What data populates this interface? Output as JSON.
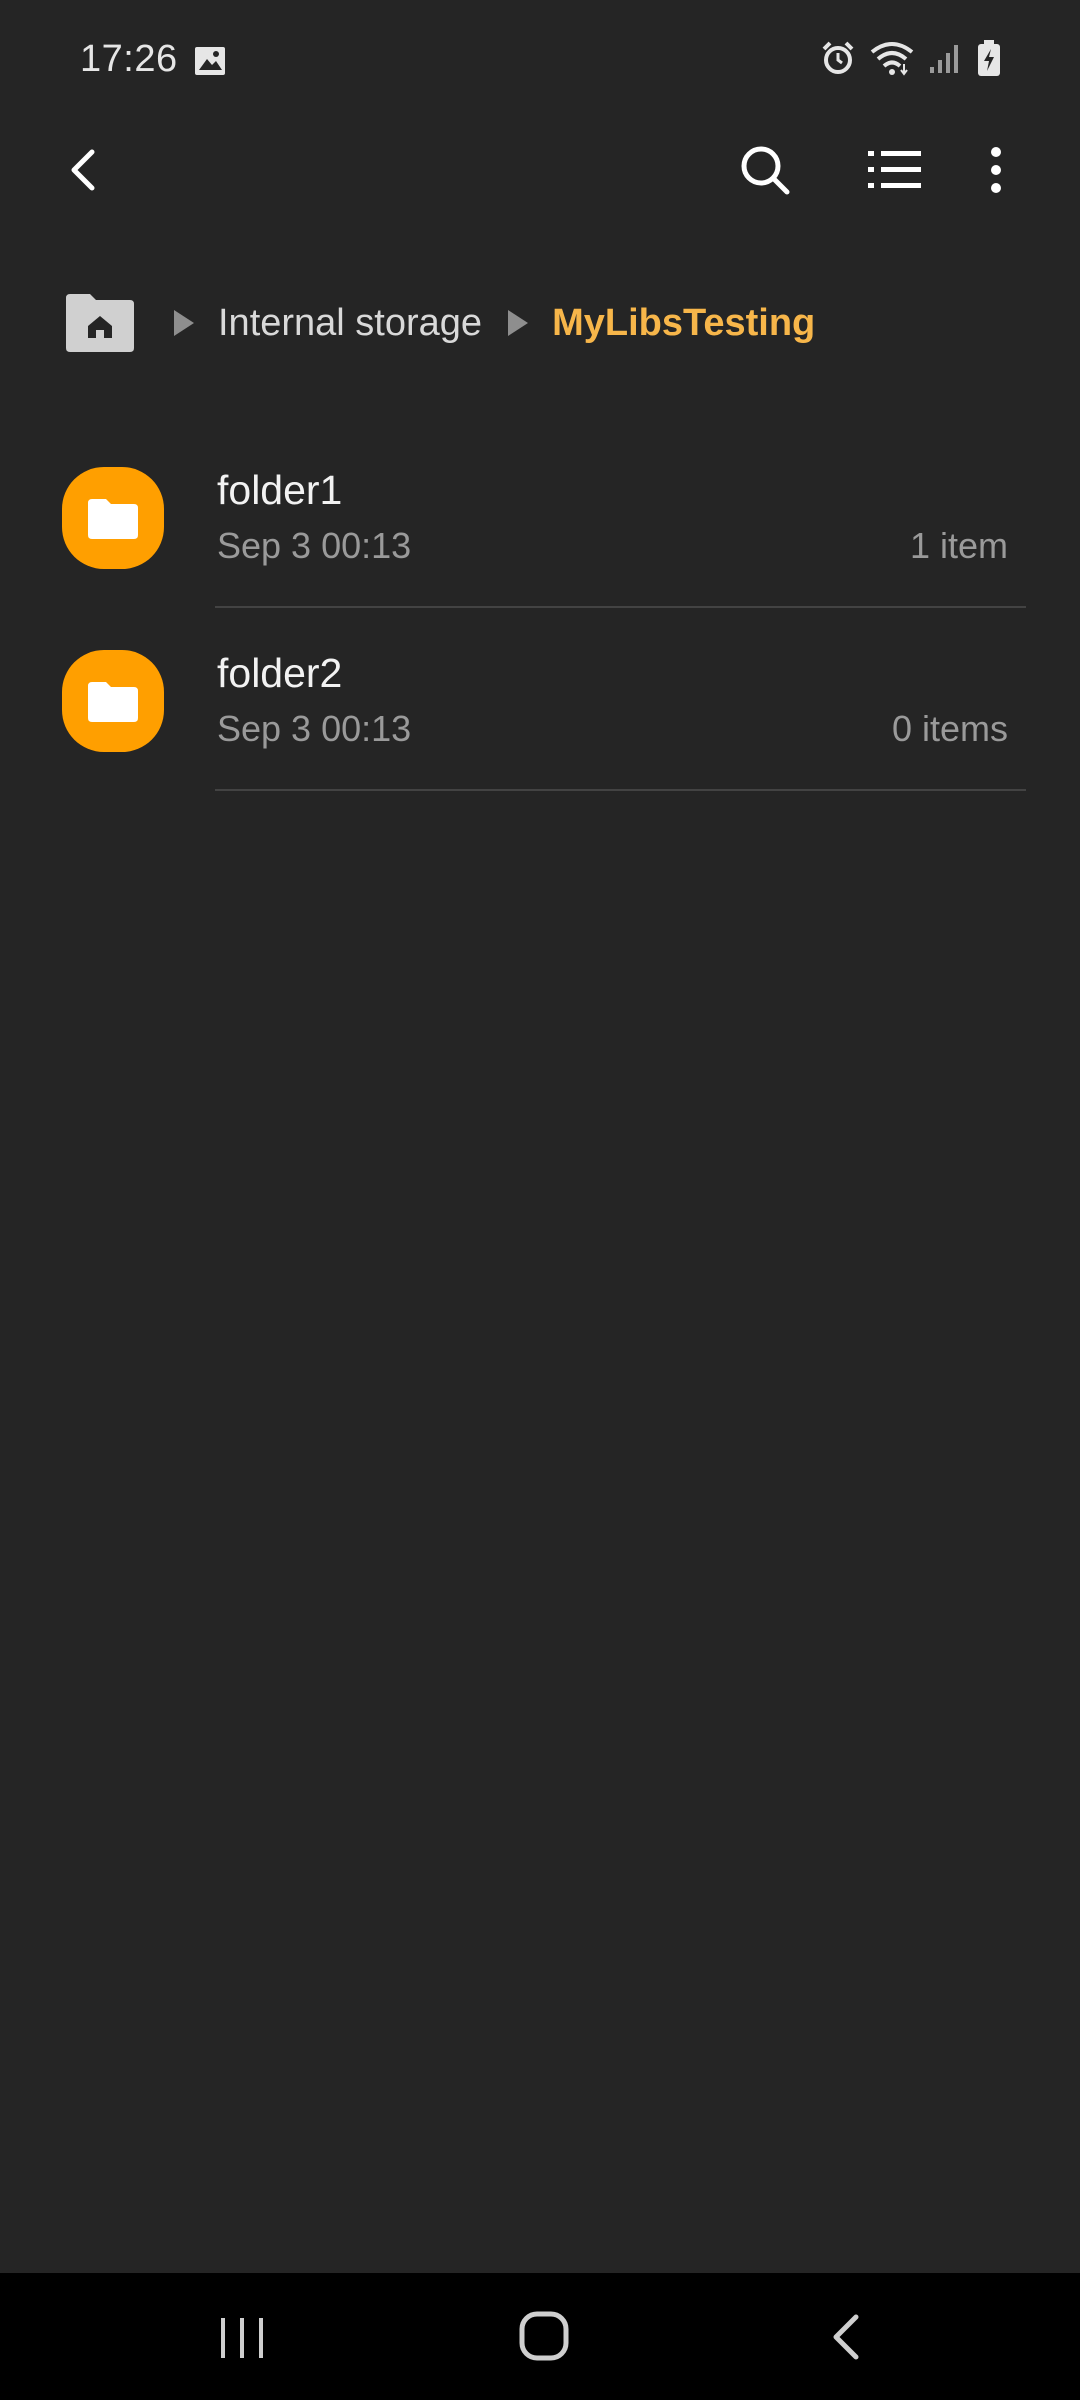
{
  "status_bar": {
    "time": "17:26",
    "icons": [
      "gallery-icon",
      "alarm-icon",
      "wifi-icon",
      "signal-icon",
      "battery-charging-icon"
    ]
  },
  "toolbar": {
    "back_icon": "back-arrow-icon",
    "search_icon": "search-icon",
    "list_view_icon": "list-view-icon",
    "more_icon": "more-vertical-icon"
  },
  "breadcrumb": {
    "home_icon": "home-folder-icon",
    "items": [
      {
        "label": "Internal storage"
      },
      {
        "label": "MyLibsTesting"
      }
    ]
  },
  "files": [
    {
      "name": "folder1",
      "date": "Sep 3 00:13",
      "count": "1 item"
    },
    {
      "name": "folder2",
      "date": "Sep 3 00:13",
      "count": "0 items"
    }
  ],
  "colors": {
    "background": "#252525",
    "accent": "#f7b64a",
    "folder": "#ff9f00",
    "nav_bar": "#000000"
  },
  "nav_bar": {
    "icons": [
      "recents-icon",
      "home-icon",
      "back-icon"
    ]
  }
}
